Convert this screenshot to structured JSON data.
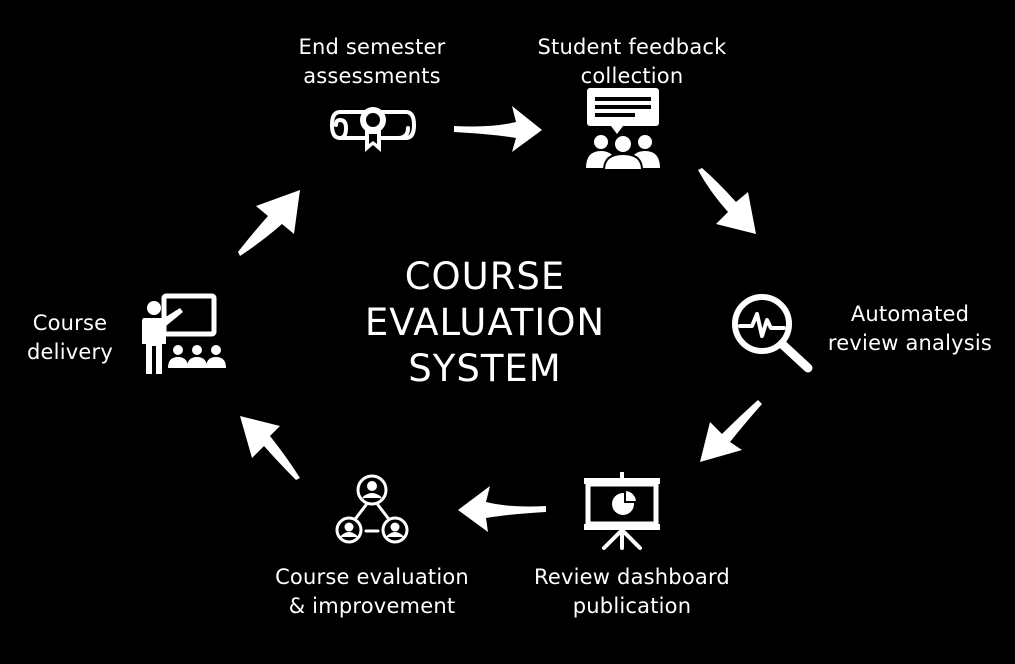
{
  "title": "COURSE\nEVALUATION\nSYSTEM",
  "steps": {
    "end_semester": {
      "label": "End semester\nassessments",
      "icon": "diploma-scroll-icon"
    },
    "feedback": {
      "label": "Student feedback\ncollection",
      "icon": "group-feedback-icon"
    },
    "analysis": {
      "label": "Automated\nreview analysis",
      "icon": "magnifier-pulse-icon"
    },
    "dashboard": {
      "label": "Review dashboard\npublication",
      "icon": "presentation-board-icon"
    },
    "improvement": {
      "label": "Course evaluation\n& improvement",
      "icon": "people-network-icon"
    },
    "delivery": {
      "label": "Course\ndelivery",
      "icon": "teacher-class-icon"
    }
  },
  "colors": {
    "background": "#000000",
    "foreground": "#ffffff"
  }
}
